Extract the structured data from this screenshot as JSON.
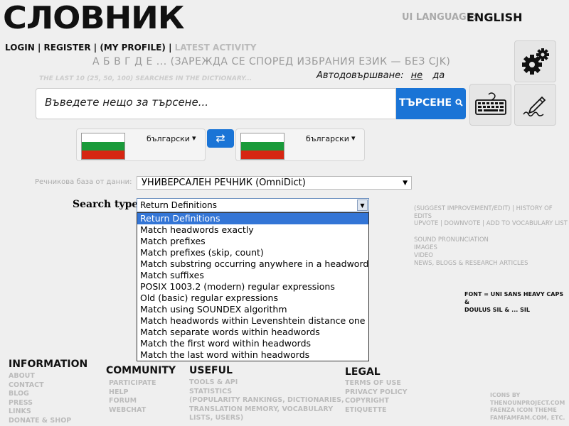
{
  "header": {
    "logo": "СЛОВНИК",
    "ui_language_label": "UI LANGUAGE:",
    "ui_language_value": "ENGLISH"
  },
  "toplinks": {
    "login": "LOGIN",
    "register": "REGISTER",
    "my_profile": "(MY PROFILE)",
    "latest_activity": "LATEST ACTIVITY",
    "sep": "|"
  },
  "alphabet": "А Б В Г Д Е ... (ЗАРЕЖДА СЕ СПОРЕД ИЗБРАНИЯ ЕЗИК — БЕЗ CJK)",
  "last_searches": "THE LAST 10 (25, 50, 100) SEARCHES IN THE DICTIONARY...",
  "autocomplete": {
    "label": "Автодовършване:",
    "no": "не",
    "yes": "да"
  },
  "search": {
    "placeholder": "Въведете нещо за търсене...",
    "button": "ТЪРСЕНЕ"
  },
  "languages": {
    "source": "български",
    "target": "български"
  },
  "flag_colors": [
    "#ffffff",
    "#1a9a3a",
    "#d62612"
  ],
  "swap_icon": "⇄",
  "dictionary": {
    "label": "Речникова база от данни:",
    "value": "УНИВЕРСАЛЕН РЕЧНИК (OmniDict)"
  },
  "search_type": {
    "label": "Search type:",
    "value": "Return Definitions",
    "options": [
      "Return Definitions",
      "Match headwords exactly",
      "Match prefixes",
      "Match prefixes (skip, count)",
      "Match substring occurring anywhere in a headword",
      "Match suffixes",
      "POSIX 1003.2 (modern) regular expressions",
      "Old (basic) regular expressions",
      "Match using SOUNDEX algorithm",
      "Match headwords within Levenshtein distance one",
      "Match separate words within headwords",
      "Match the first word within headwords",
      "Match the last word within headwords"
    ]
  },
  "right_links": {
    "suggest": "(SUGGEST IMPROVEMENT/EDIT) | HISTORY OF EDITS",
    "votes": "UPVOTE | DOWNVOTE | ADD TO VOCABULARY LIST",
    "media": [
      "SOUND PRONUNCIATION",
      "IMAGES",
      "VIDEO",
      "NEWS, BLOGS & RESEARCH ARTICLES"
    ]
  },
  "font_note": [
    "FONT = UNI SANS HEAVY CAPS",
    "&",
    "DOULUS SIL & ... SIL"
  ],
  "footer": {
    "information": {
      "title": "INFORMATION",
      "items": [
        "ABOUT",
        "CONTACT",
        "BLOG",
        "PRESS",
        "LINKS",
        "DONATE & SHOP"
      ]
    },
    "community": {
      "title": "COMMUNITY",
      "items": [
        "PARTICIPATE",
        "HELP",
        "FORUM",
        "WEBCHAT"
      ]
    },
    "useful": {
      "title": "USEFUL",
      "items": [
        "TOOLS & API",
        "STATISTICS",
        "(POPULARITY RANKINGS, DICTIONARIES,",
        "TRANSLATION MEMORY, VOCABULARY",
        "LISTS, USERS)"
      ]
    },
    "legal": {
      "title": "LEGAL",
      "items": [
        "TERMS OF USE",
        "PRIVACY POLICY",
        "COPYRIGHT",
        "ETIQUETTE"
      ]
    },
    "credits": [
      "ICONS BY",
      "THENOUNPROJECT.COM",
      "FAENZA ICON THEME",
      "FAMFAMFAM.COM, ETC."
    ]
  },
  "icons": {
    "settings": "gear-icon",
    "keyboard": "keyboard-icon",
    "handwriting": "pen-icon",
    "search": "search-icon"
  },
  "colors": {
    "accent": "#1a74d6",
    "highlight": "#3375d6"
  }
}
